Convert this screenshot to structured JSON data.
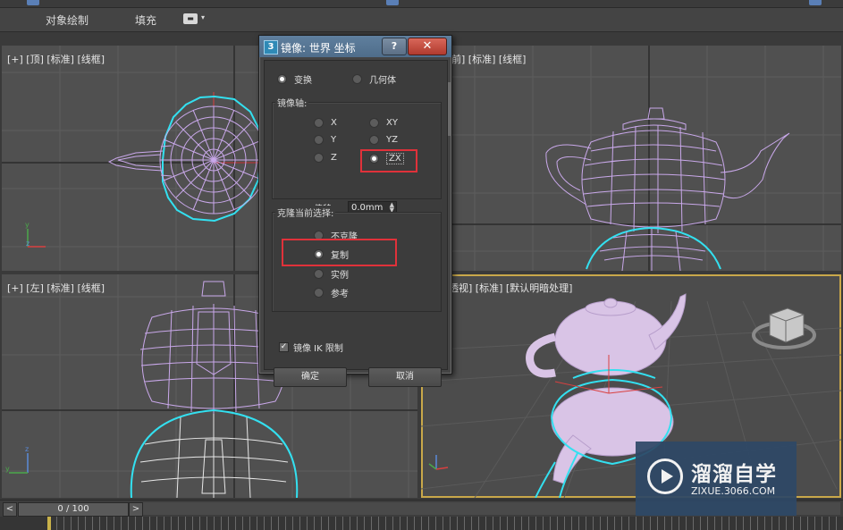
{
  "ribbon": {
    "tab_object_paint": "对象绘制",
    "tab_populate": "填充"
  },
  "viewports": {
    "top": "[+] [顶] [标准] [线框]",
    "front": "前] [标准] [线框]",
    "left": "[+] [左] [标准] [线框]",
    "perspective": "透视] [标准] [默认明暗处理]"
  },
  "dialog": {
    "title": "镜像: 世界 坐标",
    "help_label": "?",
    "close_label": "✕",
    "mode_transform": "变换",
    "mode_geometry": "几何体",
    "axis_group_label": "镜像轴:",
    "axis_x": "X",
    "axis_y": "Y",
    "axis_z": "Z",
    "axis_xy": "XY",
    "axis_yz": "YZ",
    "axis_zx": "ZX",
    "selected_axis": "ZX",
    "offset_label": "偏移:",
    "offset_value": "0.0mm",
    "clone_group_label": "克隆当前选择:",
    "clone_none": "不克隆",
    "clone_copy": "复制",
    "clone_instance": "实例",
    "clone_reference": "参考",
    "selected_clone": "复制",
    "mirror_ik_label": "镜像 IK 限制",
    "mirror_ik_checked": true,
    "ok_label": "确定",
    "cancel_label": "取消"
  },
  "timeline": {
    "frame_readout": "0 / 100",
    "prev_label": "<",
    "next_label": ">"
  },
  "watermark": {
    "brand": "溜溜自学",
    "url": "ZIXUE.3066.COM"
  },
  "colors": {
    "wireframe": "#c9a8ea",
    "selection": "#33e0f0",
    "highlight_box": "#e0313a",
    "dialog_title": "#5f7f9e"
  }
}
